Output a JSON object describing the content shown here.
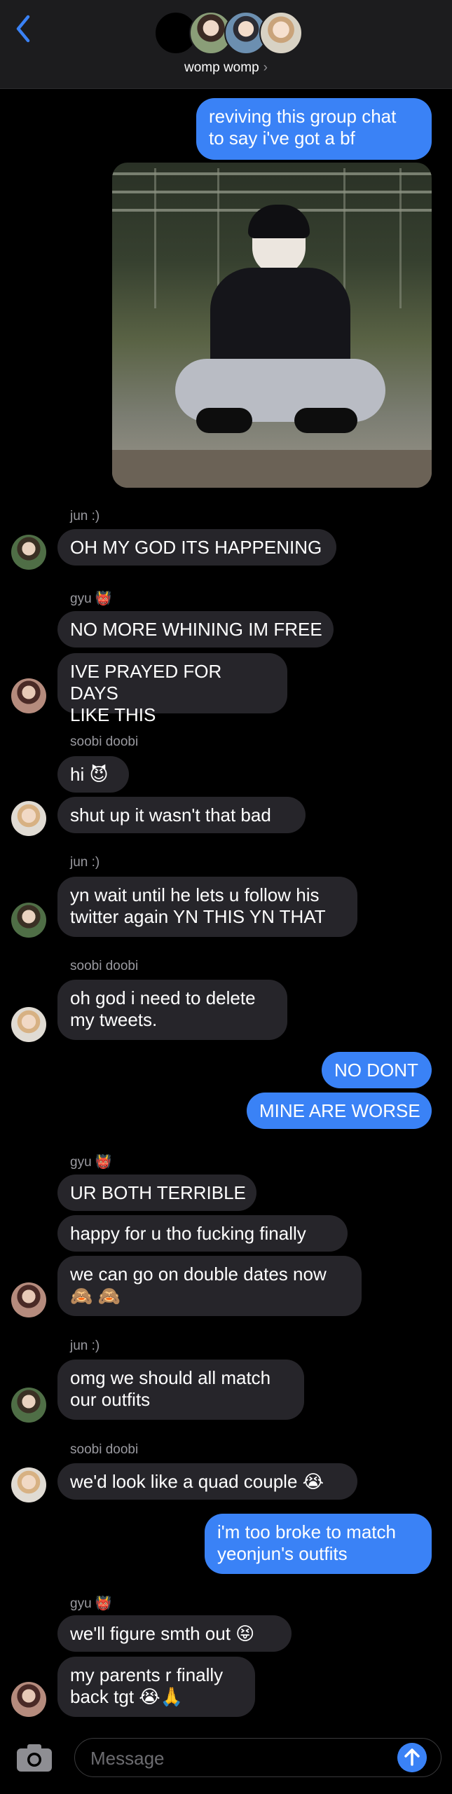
{
  "header": {
    "group_name": "womp womp",
    "chevron": "›"
  },
  "messages": [
    {
      "from": "me",
      "text": "reviving this group chat\nto say i've got a bf"
    },
    {
      "from": "me",
      "type": "photo"
    },
    {
      "sender_label": "jun :)"
    },
    {
      "from": "jun",
      "text": "OH MY GOD ITS HAPPENING"
    },
    {
      "sender_label": "gyu 👹"
    },
    {
      "from": "gyu",
      "text": "NO MORE WHINING IM FREE"
    },
    {
      "from": "gyu",
      "text": "IVE PRAYED FOR DAYS\nLIKE THIS"
    },
    {
      "sender_label": "soobi doobi"
    },
    {
      "from": "soobi",
      "text": "hi 😈"
    },
    {
      "from": "soobi",
      "text": "shut up it wasn't that bad"
    },
    {
      "sender_label": "jun :)"
    },
    {
      "from": "jun",
      "text": "yn wait until he lets u follow his\ntwitter again YN THIS YN THAT"
    },
    {
      "sender_label": "soobi doobi"
    },
    {
      "from": "soobi",
      "text": "oh god i need to delete\nmy tweets."
    },
    {
      "from": "me",
      "text": "NO DONT"
    },
    {
      "from": "me",
      "text": "MINE ARE WORSE"
    },
    {
      "sender_label": "gyu 👹"
    },
    {
      "from": "gyu",
      "text": "UR BOTH TERRIBLE"
    },
    {
      "from": "gyu",
      "text": "happy for u tho fucking finally"
    },
    {
      "from": "gyu",
      "text": "we can go on double dates now\n🙈 🙈"
    },
    {
      "sender_label": "jun :)"
    },
    {
      "from": "jun",
      "text": "omg we should all match\nour outfits"
    },
    {
      "sender_label": "soobi doobi"
    },
    {
      "from": "soobi",
      "text": "we'd look like a quad couple 😭"
    },
    {
      "from": "me",
      "text": "i'm too broke to match\nyeonjun's outfits"
    },
    {
      "sender_label": "gyu 👹"
    },
    {
      "from": "gyu",
      "text": "we'll figure smth out 😝"
    },
    {
      "from": "gyu",
      "text": "my parents r finally\nback tgt 😭🙏"
    }
  ],
  "input": {
    "placeholder": "Message"
  },
  "icons": [
    "back-chevron-icon",
    "camera-icon",
    "send-arrow-icon"
  ],
  "colors": {
    "sent": "#3a82f6",
    "received": "#26252a",
    "background": "#000000",
    "header": "#1c1c1e"
  }
}
